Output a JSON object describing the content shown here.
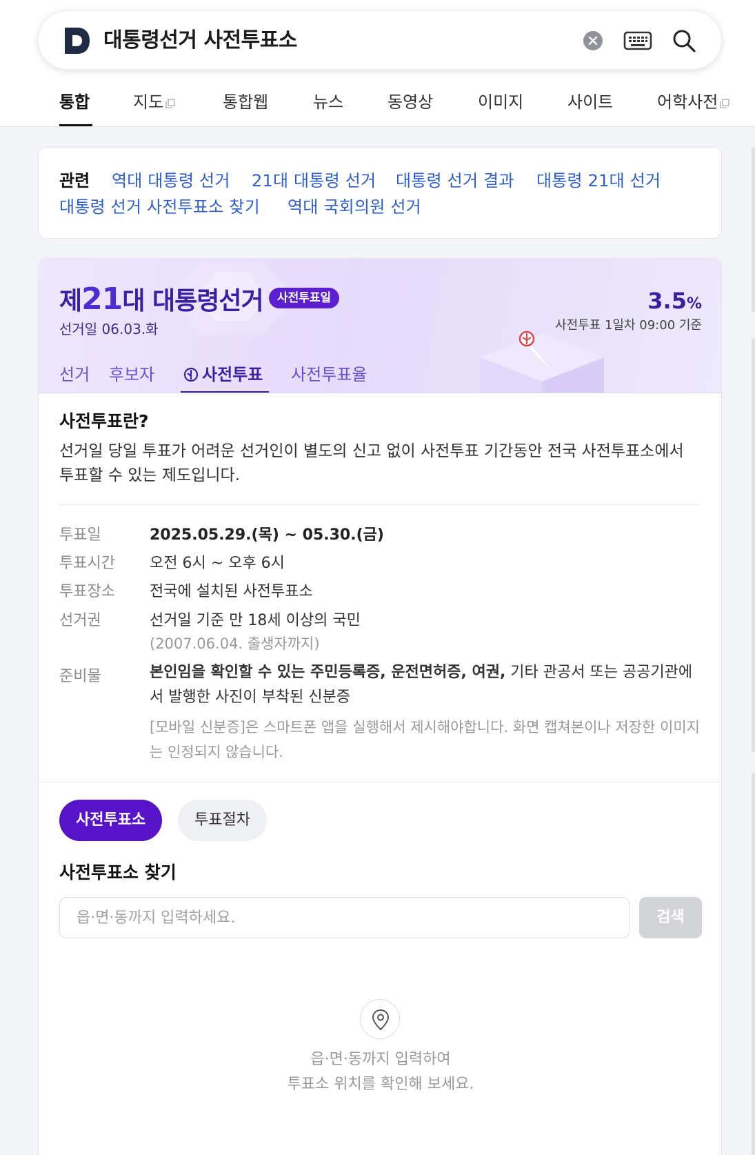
{
  "search": {
    "query": "대통령선거 사전투표소",
    "clear_icon": "clear-icon",
    "keyboard_icon": "keyboard-icon",
    "search_icon": "search-icon"
  },
  "tabs": [
    {
      "label": "통합",
      "active": true
    },
    {
      "label": "지도",
      "external": true
    },
    {
      "label": "통합웹"
    },
    {
      "label": "뉴스"
    },
    {
      "label": "동영상"
    },
    {
      "label": "이미지"
    },
    {
      "label": "사이트"
    },
    {
      "label": "어학사전",
      "external": true
    }
  ],
  "related": {
    "title": "관련",
    "links": [
      "역대 대통령 선거",
      "21대 대통령 선거",
      "대통령 선거 결과",
      "대통령 21대 선거",
      "대통령 선거 사전투표소 찾기",
      "역대 국회의원 선거"
    ]
  },
  "election": {
    "title_prefix": "제",
    "title_number": "21",
    "title_suffix": "대 대통령선거",
    "badge": "사전투표일",
    "date": "선거일 06.03.화",
    "turnout_value": "3.5",
    "turnout_unit": "%",
    "turnout_note": "사전투표 1일차 09:00 기준",
    "subtabs": [
      {
        "label": "선거"
      },
      {
        "label": "후보자"
      },
      {
        "label": "사전투표",
        "active": true,
        "icon": "vote-stamp-icon"
      },
      {
        "label": "사전투표율"
      }
    ]
  },
  "about": {
    "heading": "사전투표란?",
    "description": "선거일 당일 투표가 어려운 선거인이 별도의 신고 없이 사전투표 기간동안 전국 사전투표소에서 투표할 수 있는 제도입니다."
  },
  "details": {
    "date_label": "투표일",
    "date_value": "2025.05.29.(목) ~ 05.30.(금)",
    "time_label": "투표시간",
    "time_value": "오전 6시 ~ 오후 6시",
    "place_label": "투표장소",
    "place_value": "전국에 설치된 사전투표소",
    "right_label": "선거권",
    "right_value": "선거일 기준 만 18세 이상의 국민",
    "right_sub": "(2007.06.04. 출생자까지)",
    "prep_label": "준비물",
    "prep_bold": "본인임을 확인할 수 있는 주민등록증, 운전면허증, 여권,",
    "prep_rest": " 기타 관공서 또는 공공기관에서 발행한 사진이 부착된 신분증",
    "prep_note": "[모바일 신분증]은 스마트폰 앱을 실행해서 제시해야합니다. 화면 캡쳐본이나 저장한 이미지는 인정되지 않습니다."
  },
  "finder": {
    "pill_active": "사전투표소",
    "pill_inactive": "투표절차",
    "heading": "사전투표소 찾기",
    "placeholder": "읍·면·동까지 입력하세요.",
    "search_button": "검색",
    "empty_icon": "location-pin-icon",
    "empty_line1": "읍·면·동까지 입력하여",
    "empty_line2": "투표소 위치를 확인해 보세요."
  }
}
